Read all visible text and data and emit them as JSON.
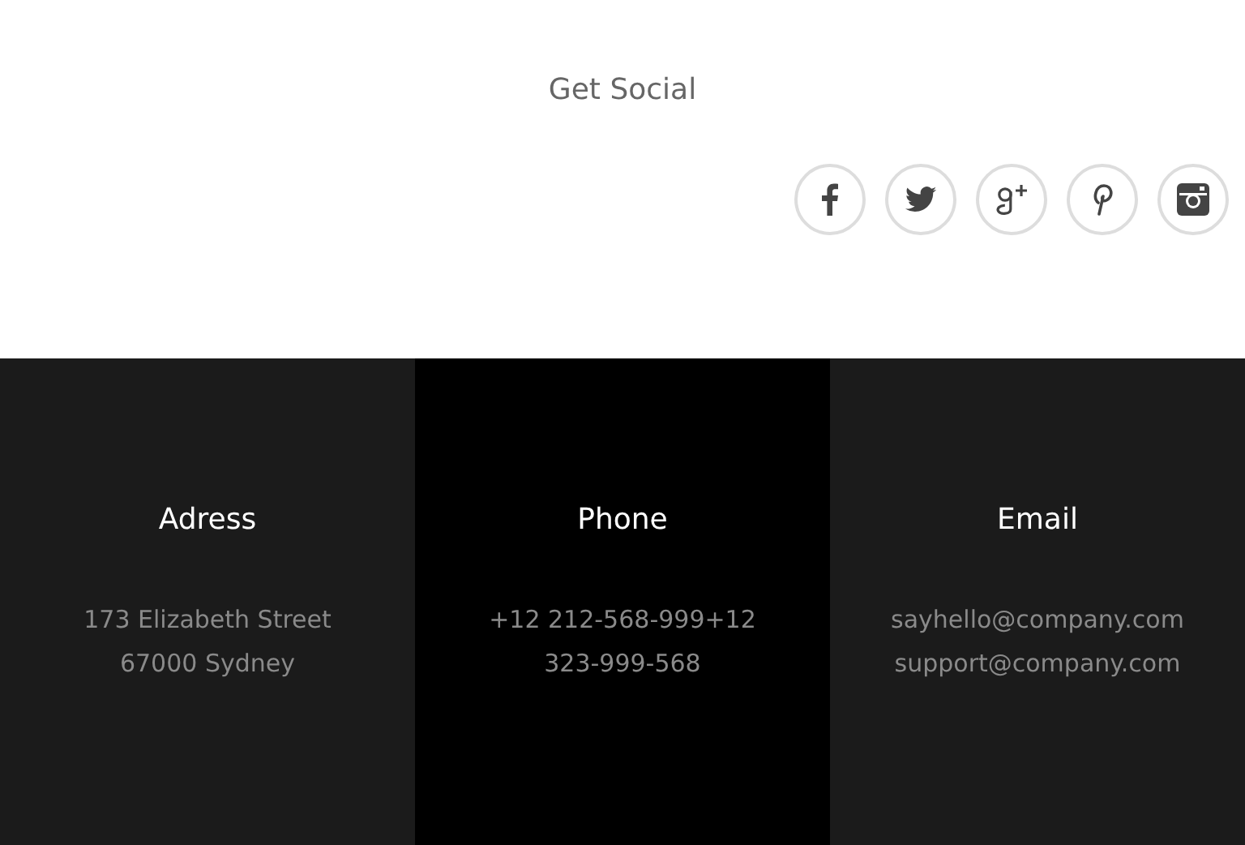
{
  "social": {
    "title": "Get Social",
    "links": [
      {
        "kind": "facebook"
      },
      {
        "kind": "twitter"
      },
      {
        "kind": "google-plus"
      },
      {
        "kind": "pinterest"
      },
      {
        "kind": "instagram"
      }
    ]
  },
  "contact": [
    {
      "title": "Adress",
      "lines": [
        "173 Elizabeth Street",
        "67000 Sydney"
      ],
      "selected": false
    },
    {
      "title": "Phone",
      "lines": [
        "+12 212-568-999+12",
        "323-999-568"
      ],
      "selected": true
    },
    {
      "title": "Email",
      "lines": [
        "sayhello@company.com",
        "support@company.com"
      ],
      "selected": false
    }
  ]
}
